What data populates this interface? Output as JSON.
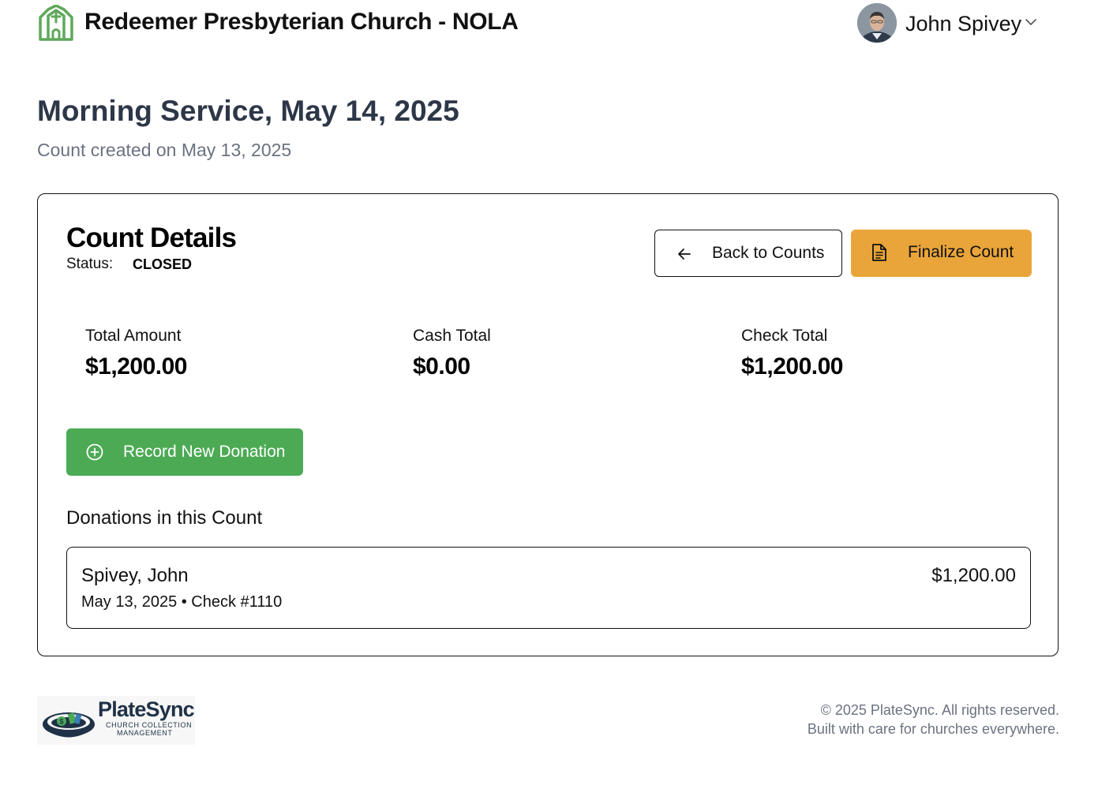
{
  "header": {
    "church_name": "Redeemer Presbyterian Church - NOLA",
    "church_icon": "church-icon",
    "user": {
      "name": "John Spivey",
      "avatar": "user-avatar",
      "menu_icon": "chevron-down-icon"
    }
  },
  "page": {
    "title": "Morning Service, May 14, 2025",
    "subtitle": "Count created on May 13, 2025"
  },
  "count_details": {
    "title": "Count Details",
    "status_label": "Status:",
    "status_value": "CLOSED",
    "back_button": {
      "label": "Back to Counts",
      "icon": "arrow-left-icon"
    },
    "finalize_button": {
      "label": "Finalize Count",
      "icon": "document-icon",
      "color": "#e9a53a"
    },
    "stats": {
      "total": {
        "label": "Total Amount",
        "value": "$1,200.00"
      },
      "cash": {
        "label": "Cash Total",
        "value": "$0.00"
      },
      "check": {
        "label": "Check Total",
        "value": "$1,200.00"
      }
    },
    "record_button": {
      "label": "Record New Donation",
      "icon": "plus-circle-icon",
      "color": "#4caa55"
    },
    "donations_heading": "Donations in this Count",
    "donations": [
      {
        "name": "Spivey, John",
        "meta": "May 13, 2025 • Check #1110",
        "amount": "$1,200.00"
      }
    ]
  },
  "footer": {
    "logo": {
      "name": "PlateSync",
      "tagline_line1": "CHURCH COLLECTION",
      "tagline_line2": "MANAGEMENT"
    },
    "copyright": "© 2025 PlateSync. All rights reserved.",
    "tagline": "Built with care for churches everywhere."
  }
}
